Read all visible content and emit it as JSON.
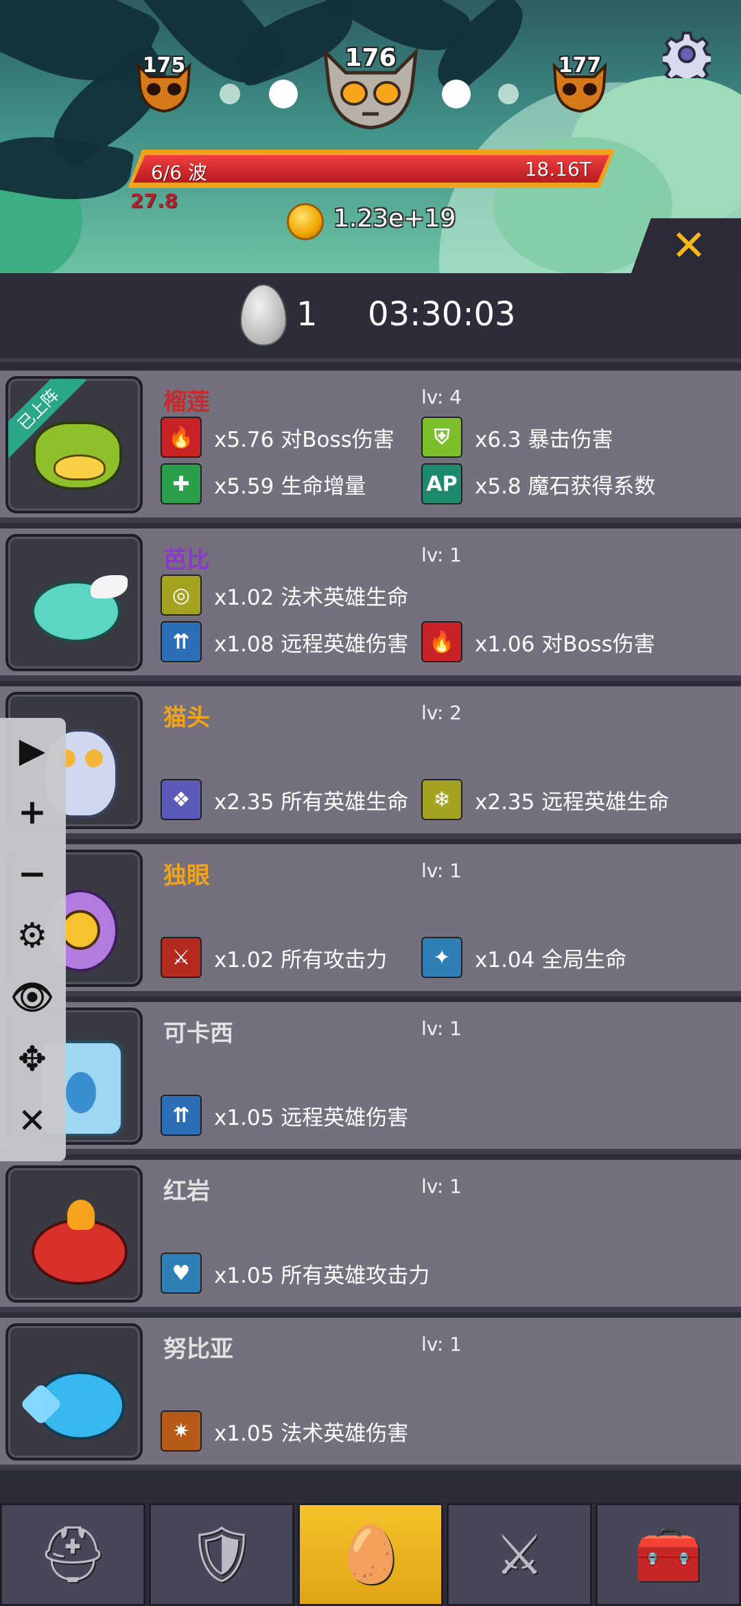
{
  "top": {
    "waves": {
      "prev": "175",
      "current": "176",
      "next": "177"
    },
    "wave_progress": {
      "label": "6/6 波",
      "hp": "18.16T",
      "fill": 1.0
    },
    "damage": "27.8",
    "coins": "1.23e+19",
    "icons": {
      "settings": "gear-icon",
      "close": "close-icon"
    },
    "close_glyph": "✕"
  },
  "egg": {
    "count": "1",
    "timer": "03:30:03"
  },
  "on_team_label": "已上阵",
  "heroes": [
    {
      "name": "榴莲",
      "lv": "lv: 4",
      "name_color": "#c62a2a",
      "on_team": true,
      "stats": [
        {
          "text": "x5.76 对Boss伤害",
          "icon": "flame-shield-icon",
          "color": "#c92226"
        },
        {
          "text": "x6.3 暴击伤害",
          "icon": "shield-icon",
          "color": "#7dbf2b"
        },
        {
          "text": "x5.59 生命增量",
          "icon": "health-figure-icon",
          "color": "#2c9f4c"
        },
        {
          "text": "x5.8 魔石获得系数",
          "icon": "ap-icon",
          "color": "#1e8a6d"
        }
      ]
    },
    {
      "name": "芭比",
      "lv": "lv: 1",
      "name_color": "#8a3ac7",
      "stats": [
        {
          "text": "x1.02 法术英雄生命",
          "icon": "halo-icon",
          "color": "#a4a321"
        },
        {
          "text": "x1.08 远程英雄伤害",
          "icon": "arrows-icon",
          "color": "#2d6fb6"
        },
        {
          "text": "x1.06 对Boss伤害",
          "icon": "flame-shield-icon",
          "color": "#c92226"
        }
      ]
    },
    {
      "name": "猫头",
      "lv": "lv: 2",
      "name_color": "#f4a316",
      "stats": [
        {
          "text": "x2.35 所有英雄生命",
          "icon": "crystal-icon",
          "color": "#5a5ab8"
        },
        {
          "text": "x2.35 远程英雄生命",
          "icon": "snowflake-icon",
          "color": "#a4a321"
        }
      ]
    },
    {
      "name": "独眼",
      "lv": "lv: 1",
      "name_color": "#f4a316",
      "stats": [
        {
          "text": "x1.02 所有攻击力",
          "icon": "sword-icon",
          "color": "#b42a1f"
        },
        {
          "text": "x1.04 全局生命",
          "icon": "burst-icon",
          "color": "#2d7fb6"
        }
      ]
    },
    {
      "name": "可卡西",
      "lv": "lv: 1",
      "name_color": "#e2e2e2",
      "stats": [
        {
          "text": "x1.05 远程英雄伤害",
          "icon": "arrows-icon",
          "color": "#2d6fb6"
        }
      ]
    },
    {
      "name": "红岩",
      "lv": "lv: 1",
      "name_color": "#e2e2e2",
      "stats": [
        {
          "text": "x1.05 所有英雄攻击力",
          "icon": "heart-burst-icon",
          "color": "#2d7fb6"
        }
      ]
    },
    {
      "name": "努比亚",
      "lv": "lv: 1",
      "name_color": "#e2e2e2",
      "stats": [
        {
          "text": "x1.05 法术英雄伤害",
          "icon": "spark-icon",
          "color": "#b85a1a"
        }
      ]
    }
  ],
  "tools": [
    {
      "name": "play",
      "glyph": "▶"
    },
    {
      "name": "plus",
      "glyph": "+"
    },
    {
      "name": "minus",
      "glyph": "−"
    },
    {
      "name": "gear",
      "glyph": "⚙"
    },
    {
      "name": "eye",
      "glyph": "👁"
    },
    {
      "name": "move",
      "glyph": "✥"
    },
    {
      "name": "close",
      "glyph": "✕"
    }
  ],
  "nav": [
    {
      "name": "helmet",
      "glyph": "⛑",
      "active": false
    },
    {
      "name": "armor",
      "glyph": "🛡",
      "active": false
    },
    {
      "name": "egg",
      "glyph": "🥚",
      "active": true
    },
    {
      "name": "crest",
      "glyph": "⚔",
      "active": false
    },
    {
      "name": "chest",
      "glyph": "🧰",
      "active": false
    }
  ]
}
